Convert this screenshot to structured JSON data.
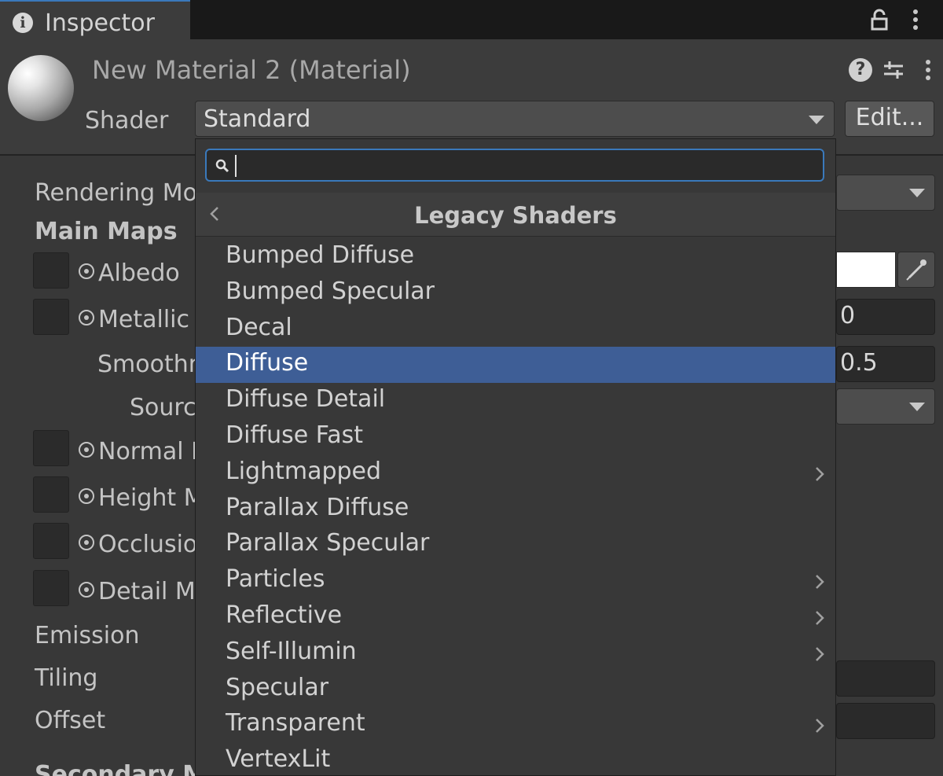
{
  "tab": {
    "title": "Inspector"
  },
  "header": {
    "material_title": "New Material 2 (Material)",
    "shader_label": "Shader",
    "shader_value": "Standard",
    "edit_label": "Edit..."
  },
  "inspector": {
    "rendering_mode_label": "Rendering Mo",
    "main_maps_label": "Main Maps",
    "albedo_label": "Albedo",
    "metallic_label": "Metallic",
    "metallic_value": "0",
    "smoothness_label": "Smoothn",
    "smoothness_value": "0.5",
    "source_label": "Sourc",
    "normal_label": "Normal I",
    "height_label": "Height M",
    "occlusion_label": "Occlusio",
    "detail_label": "Detail M",
    "emission_label": "Emission",
    "tiling_label": "Tiling",
    "offset_label": "Offset",
    "secondary_label": "Secondary M",
    "albedo_color": "#ffffff"
  },
  "popup": {
    "search_value": "",
    "breadcrumb": "Legacy Shaders",
    "items": [
      {
        "label": "Bumped Diffuse",
        "submenu": false,
        "selected": false
      },
      {
        "label": "Bumped Specular",
        "submenu": false,
        "selected": false
      },
      {
        "label": "Decal",
        "submenu": false,
        "selected": false
      },
      {
        "label": "Diffuse",
        "submenu": false,
        "selected": true
      },
      {
        "label": "Diffuse Detail",
        "submenu": false,
        "selected": false
      },
      {
        "label": "Diffuse Fast",
        "submenu": false,
        "selected": false
      },
      {
        "label": "Lightmapped",
        "submenu": true,
        "selected": false
      },
      {
        "label": "Parallax Diffuse",
        "submenu": false,
        "selected": false
      },
      {
        "label": "Parallax Specular",
        "submenu": false,
        "selected": false
      },
      {
        "label": "Particles",
        "submenu": true,
        "selected": false
      },
      {
        "label": "Reflective",
        "submenu": true,
        "selected": false
      },
      {
        "label": "Self-Illumin",
        "submenu": true,
        "selected": false
      },
      {
        "label": "Specular",
        "submenu": false,
        "selected": false
      },
      {
        "label": "Transparent",
        "submenu": true,
        "selected": false
      },
      {
        "label": "VertexLit",
        "submenu": false,
        "selected": false
      }
    ]
  },
  "colors": {
    "selection": "#3e5e96",
    "focus_accent": "#3a79bb",
    "panel_bg": "#383838"
  }
}
